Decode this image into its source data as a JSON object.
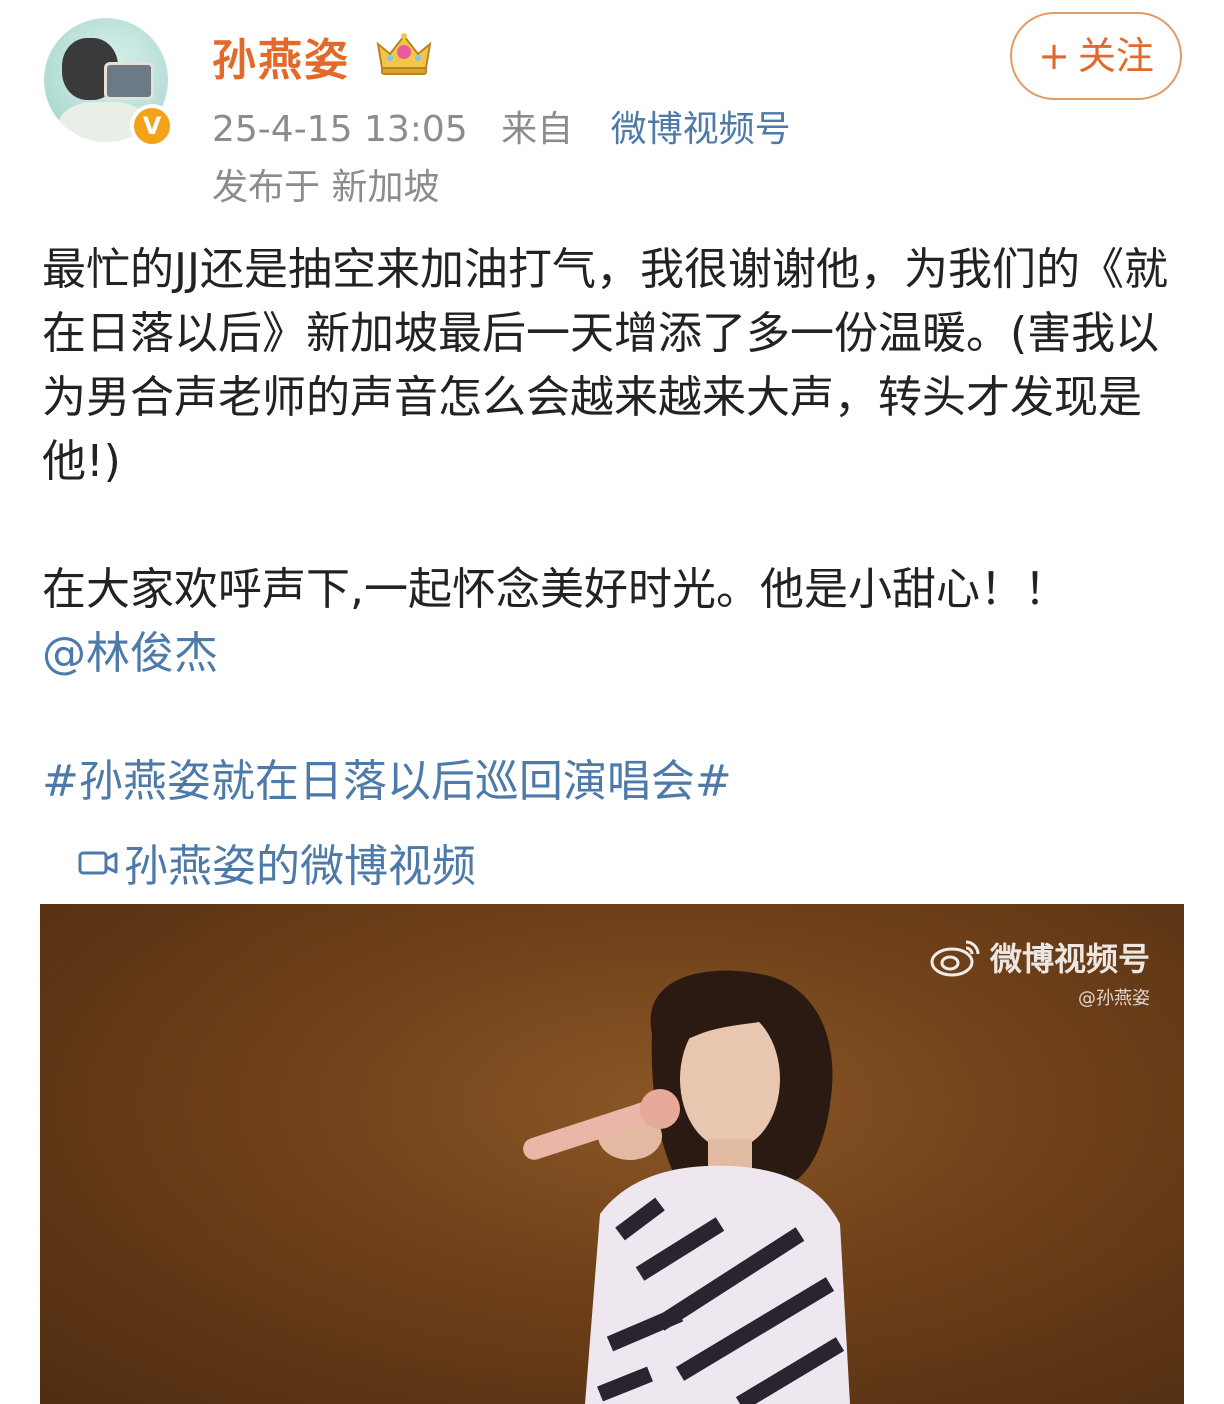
{
  "header": {
    "name": "孙燕姿",
    "timestamp": "25-4-15 13:05",
    "from_label": "来自",
    "source": "微博视频号",
    "location": "发布于 新加坡",
    "verified_badge": "V",
    "follow_plus": "+",
    "follow_label": "关注"
  },
  "post": {
    "paragraph1": "最忙的JJ还是抽空来加油打气，我很谢谢他，为我们的《就在日落以后》新加坡最后一天增添了多一份温暖。(害我以为男合声老师的声音怎么会越来越来大声，转头才发现是他!)",
    "paragraph2": "在大家欢呼声下,一起怀念美好时光。他是小甜心！！",
    "mention": "@林俊杰",
    "topic": "#孙燕姿就在日落以后巡回演唱会#",
    "video_link": "孙燕姿的微博视频"
  },
  "video": {
    "watermark_title": "微博视频号",
    "watermark_sub": "@孙燕姿"
  },
  "colors": {
    "name_orange": "#e2692a",
    "link_blue": "#4d7aa8",
    "meta_gray": "#8c8c8c",
    "badge_orange": "#f2a31a"
  },
  "icons": [
    "crown-icon",
    "verified-badge-icon",
    "video-camera-icon",
    "weibo-logo-icon"
  ]
}
